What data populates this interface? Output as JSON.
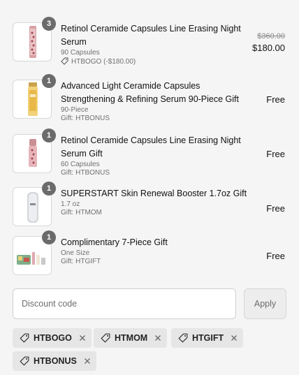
{
  "items": [
    {
      "qty": "3",
      "title_line1": "Retinol Ceramide Capsules Line Erasing Night",
      "title_line2": "Serum",
      "meta": "90 Capsules",
      "discount": "HTBOGO (-$180.00)",
      "compare_price": "$360.00",
      "price": "$180.00"
    },
    {
      "qty": "1",
      "title_line1": "Advanced Light Ceramide Capsules",
      "title_line2": "Strengthening & Refining Serum 90-Piece Gift",
      "meta": "90-Piece",
      "gift": "Gift: HTBONUS",
      "price": "Free"
    },
    {
      "qty": "1",
      "title_line1": "Retinol Ceramide Capsules Line Erasing Night",
      "title_line2": "Serum Gift",
      "meta": "60 Capsules",
      "gift": "Gift: HTBONUS",
      "price": "Free"
    },
    {
      "qty": "1",
      "title_line1": "SUPERSTART Skin Renewal Booster 1.7oz Gift",
      "meta": "1.7 oz",
      "gift": "Gift: HTMOM",
      "price": "Free"
    },
    {
      "qty": "1",
      "title_line1": "Complimentary 7-Piece Gift",
      "meta": "One Size",
      "gift": "Gift: HTGIFT",
      "price": "Free"
    }
  ],
  "discount_form": {
    "placeholder": "Discount code",
    "apply_label": "Apply"
  },
  "applied_codes": [
    "HTBOGO",
    "HTMOM",
    "HTGIFT",
    "HTBONUS"
  ],
  "icons": {
    "tag": "tag-icon",
    "remove": "close-icon"
  },
  "colors": {
    "background": "#f5f5f5",
    "badge": "#6b6b6b",
    "chip": "#e6e6e6"
  }
}
